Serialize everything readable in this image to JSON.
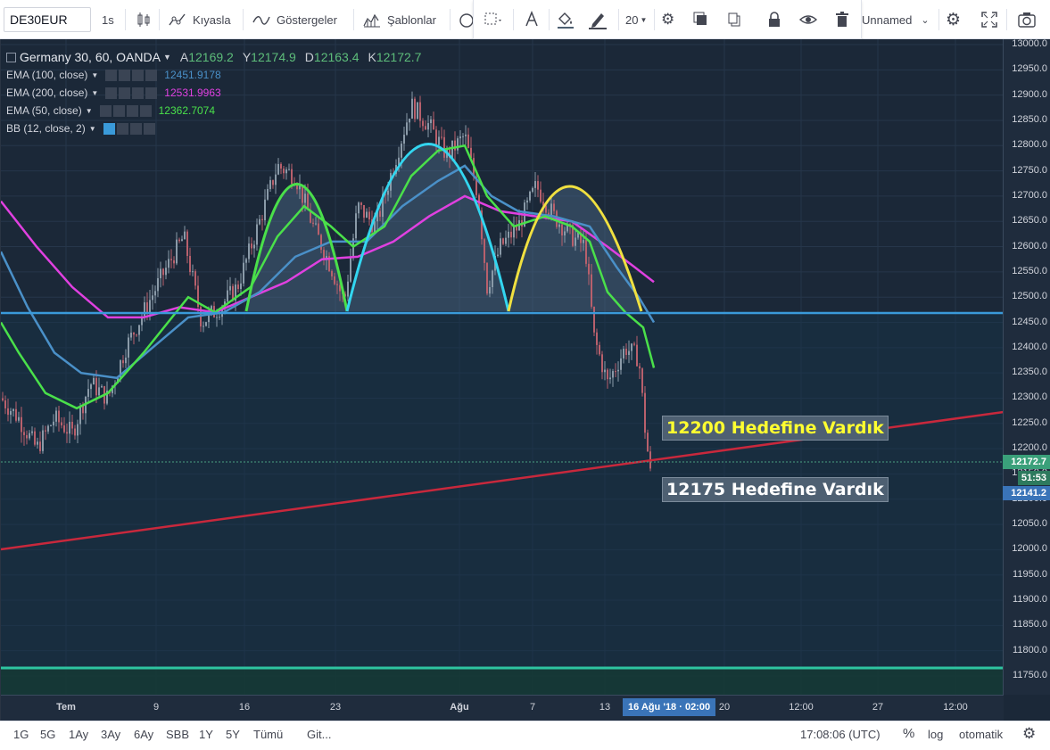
{
  "toolbar": {
    "symbol": "DE30EUR",
    "interval": "1s",
    "compare_label": "Kıyasla",
    "indicators_label": "Göstergeler",
    "templates_label": "Şablonlar",
    "font_size": "20",
    "layout_name": "Unnamed"
  },
  "legend": {
    "title": "Germany 30, 60, OANDA",
    "ohlc": {
      "o_label": "A",
      "o": "12169.2",
      "h_label": "Y",
      "h": "12174.9",
      "l_label": "D",
      "l": "12163.4",
      "c_label": "K",
      "c": "12172.7"
    },
    "studies": [
      {
        "label": "EMA (100, close)",
        "value": "12451.9178",
        "color": "#4a90c8"
      },
      {
        "label": "EMA (200, close)",
        "value": "12531.9963",
        "color": "#e040e0"
      },
      {
        "label": "EMA (50, close)",
        "value": "12362.7074",
        "color": "#4ae04a"
      },
      {
        "label": "BB (12, close, 2)",
        "value": "",
        "color": "#3a9ad9"
      }
    ]
  },
  "price_scale": {
    "ticks": [
      "13000.0",
      "12950.0",
      "12900.0",
      "12850.0",
      "12800.0",
      "12750.0",
      "12700.0",
      "12650.0",
      "12600.0",
      "12550.0",
      "12500.0",
      "12450.0",
      "12400.0",
      "12350.0",
      "12300.0",
      "12250.0",
      "12200.0",
      "12150.0",
      "12100.0",
      "12050.0",
      "12000.0",
      "11950.0",
      "11900.0",
      "11850.0",
      "11800.0",
      "11750.0"
    ],
    "last_price": "12172.7",
    "countdown": "51:53",
    "cursor_price": "12141.2"
  },
  "time_scale": {
    "ticks": [
      "Tem",
      "9",
      "16",
      "23",
      "Ağu",
      "7",
      "13",
      "20",
      "12:00",
      "27",
      "12:00"
    ],
    "cursor_label": "16 Ağu '18 · 02:00"
  },
  "annotations": {
    "target1": "12200 Hedefine Vardık",
    "target2": "12175 Hedefine Vardık"
  },
  "bottom_bar": {
    "ranges": [
      "1G",
      "5G",
      "1Ay",
      "3Ay",
      "6Ay",
      "SBB",
      "1Y",
      "5Y",
      "Tümü"
    ],
    "goto_label": "Git...",
    "clock": "17:08:06 (UTC)",
    "percent_label": "%",
    "log_label": "log",
    "auto_label": "otomatik"
  },
  "colors": {
    "chart_bg": "#1b2838",
    "neckline": "#3a9ad9",
    "trendline": "#c8283c",
    "support": "#2ec4a0",
    "ema100": "#4a90c8",
    "ema200": "#e040e0",
    "ema50": "#4ae04a",
    "arc_left": "#4ae04a",
    "arc_head": "#33d6f0",
    "arc_right": "#f0e040",
    "target1_text": "#ffff30",
    "target2_text": "#ffffff"
  }
}
